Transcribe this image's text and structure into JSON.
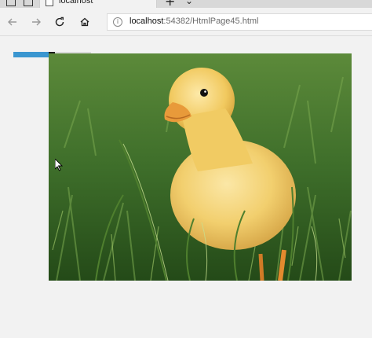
{
  "browser": {
    "tab_title": "localhost",
    "address": {
      "host": "localhost",
      "rest": ":54382/HtmlPage45.html"
    }
  },
  "icons": {
    "back": "back-arrow-icon",
    "forward": "forward-arrow-icon",
    "refresh": "refresh-icon",
    "home": "home-icon",
    "info": "info-icon",
    "new_tab": "plus-icon",
    "tab_menu": "chevron-down-icon"
  },
  "page": {
    "progress_fraction": 0.45,
    "image_subject": "duckling-in-grass"
  },
  "colors": {
    "progress_fill": "#3a96d0",
    "page_bg": "#f2f2f2"
  }
}
